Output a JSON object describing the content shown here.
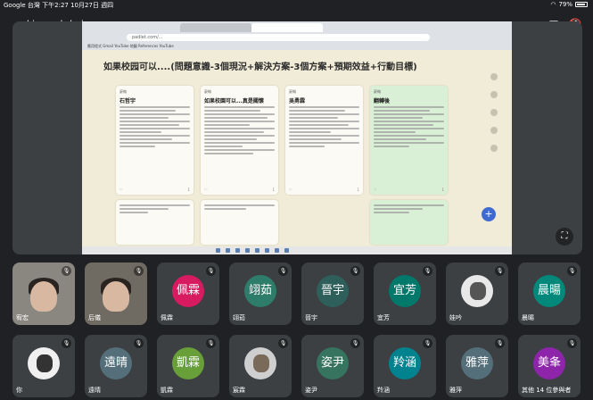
{
  "status_bar": {
    "left": "Google 台灣  下午2:27  10月27日 週四",
    "battery": "79%"
  },
  "meet": {
    "meeting_code": "kic-ggsh-kpj"
  },
  "shared_screen": {
    "address": "padlet.com/...",
    "bookmarks": "應用程式  Gmail  YouTube  地圖  References  YouTube",
    "padlet_sub": "",
    "title": "如果校园可以....(問題意識-3個現況+解決方案-3個方案+預期效益+行動目標)",
    "columns": [
      {
        "author": "豪翰",
        "title": "石哲宇",
        "lines": 12,
        "likes": "1"
      },
      {
        "author": "豪翰",
        "title": "如果校園可以...真是關懷",
        "lines": 14,
        "likes": "1"
      },
      {
        "author": "豪翰",
        "title": "吳勇霖",
        "lines": 12,
        "likes": "1"
      },
      {
        "author": "豪翰",
        "title": "翻轉後",
        "lines": 12,
        "likes": "1"
      }
    ]
  },
  "participants": [
    {
      "name": "宥宏",
      "initial": "",
      "color": "",
      "type": "video"
    },
    {
      "name": "后儀",
      "initial": "",
      "color": "",
      "type": "video2"
    },
    {
      "name": "佩霖",
      "initial": "佩霖",
      "color": "#d81b60",
      "type": "avatar"
    },
    {
      "name": "翊茹",
      "initial": "翊茹",
      "color": "#2e7d6a",
      "type": "avatar"
    },
    {
      "name": "晉宇",
      "initial": "晉宇",
      "color": "#2f5f5a",
      "type": "avatar"
    },
    {
      "name": "宜芳",
      "initial": "宜芳",
      "color": "#00796b",
      "type": "avatar"
    },
    {
      "name": "娃吟",
      "initial": "",
      "color": "",
      "type": "photo"
    },
    {
      "name": "晨暘",
      "initial": "晨暘",
      "color": "#00897b",
      "type": "avatar"
    },
    {
      "name": "你",
      "initial": "",
      "color": "",
      "type": "photo2"
    },
    {
      "name": "遠晴",
      "initial": "遠晴",
      "color": "#546e7a",
      "type": "avatar"
    },
    {
      "name": "凱霖",
      "initial": "凱霖",
      "color": "#689f38",
      "type": "avatar"
    },
    {
      "name": "宸霖",
      "initial": "",
      "color": "",
      "type": "photo3"
    },
    {
      "name": "姿尹",
      "initial": "姿尹",
      "color": "#37745f",
      "type": "avatar"
    },
    {
      "name": "羚涵",
      "initial": "羚涵",
      "color": "#00838f",
      "type": "avatar"
    },
    {
      "name": "雅萍",
      "initial": "雅萍",
      "color": "#546e7a",
      "type": "avatar"
    },
    {
      "name": "其他 14 位參與者",
      "initial": "美夆",
      "color": "#8e24aa",
      "type": "avatar"
    }
  ]
}
